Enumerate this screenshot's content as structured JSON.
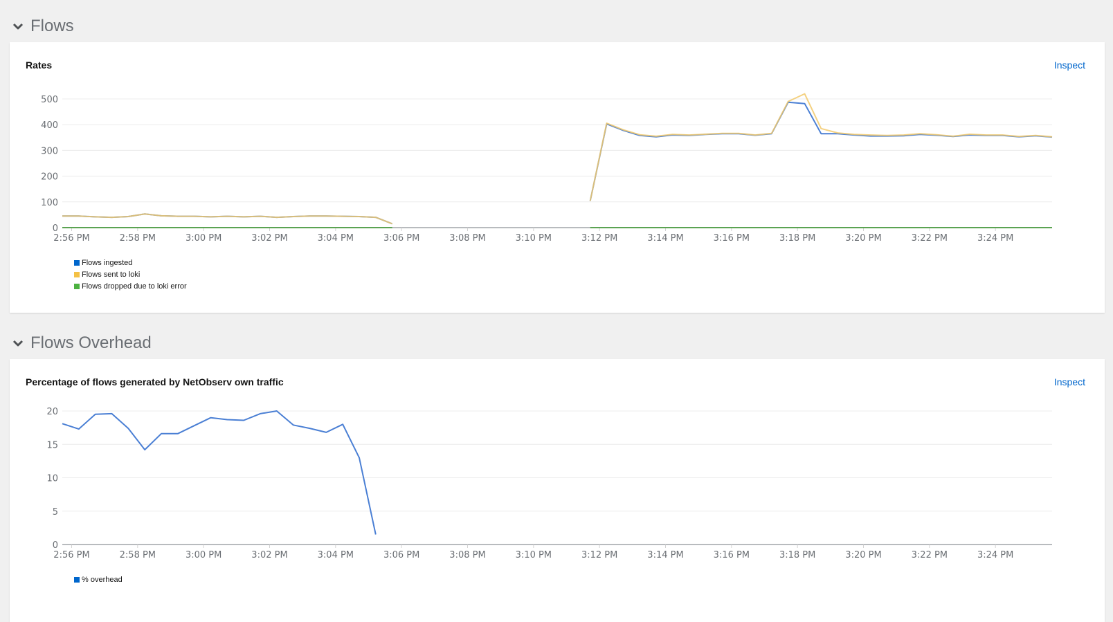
{
  "sections": [
    {
      "title": "Flows",
      "expanded": true,
      "card": {
        "title": "Rates",
        "inspect_label": "Inspect"
      }
    },
    {
      "title": "Flows Overhead",
      "expanded": true,
      "card": {
        "title": "Percentage of flows generated by NetObserv own traffic",
        "inspect_label": "Inspect"
      }
    }
  ],
  "chart_data": [
    {
      "type": "line",
      "title": "Rates",
      "xlabel": "",
      "ylabel": "",
      "ylim": [
        0,
        520
      ],
      "yticks": [
        0,
        100,
        200,
        300,
        400,
        500
      ],
      "xticks": [
        "2:56 PM",
        "2:58 PM",
        "3:00 PM",
        "3:02 PM",
        "3:04 PM",
        "3:06 PM",
        "3:08 PM",
        "3:10 PM",
        "3:12 PM",
        "3:14 PM",
        "3:16 PM",
        "3:18 PM",
        "3:20 PM",
        "3:22 PM",
        "3:24 PM"
      ],
      "x_range_minutes": [
        "2:55:43 PM",
        "3:25:43 PM"
      ],
      "grid": true,
      "legend_position": "bottom-left",
      "series": [
        {
          "name": "Flows ingested",
          "color": "#06c",
          "line_color": "#4a7fd4",
          "segments": [
            {
              "start": "2:55:43 PM",
              "step_seconds": 30,
              "values": [
                45,
                45,
                42,
                40,
                43,
                53,
                46,
                44,
                44,
                42,
                44,
                42,
                44,
                40,
                43,
                45,
                45,
                44,
                43,
                40,
                15
              ]
            },
            {
              "start": "3:11:43 PM",
              "step_seconds": 30,
              "values": [
                104,
                403,
                378,
                358,
                353,
                360,
                358,
                362,
                365,
                365,
                359,
                365,
                487,
                482,
                365,
                365,
                360,
                356,
                356,
                357,
                362,
                359,
                354,
                360,
                358,
                358,
                353,
                357,
                352
              ]
            }
          ]
        },
        {
          "name": "Flows sent to loki",
          "color": "#f4c145",
          "line_color": "#f2c96b",
          "segments": [
            {
              "start": "2:55:43 PM",
              "step_seconds": 30,
              "values": [
                45,
                45,
                42,
                40,
                43,
                53,
                46,
                44,
                44,
                42,
                44,
                42,
                44,
                40,
                43,
                45,
                45,
                44,
                43,
                40,
                15
              ]
            },
            {
              "start": "3:11:43 PM",
              "step_seconds": 30,
              "values": [
                104,
                406,
                380,
                361,
                355,
                362,
                360,
                363,
                366,
                366,
                360,
                366,
                490,
                520,
                385,
                368,
                362,
                360,
                358,
                360,
                365,
                361,
                355,
                363,
                360,
                360,
                354,
                358,
                353
              ]
            }
          ]
        },
        {
          "name": "Flows dropped due to loki error",
          "color": "#4cb140",
          "line_color": "#5ba352",
          "segments": [
            {
              "start": "2:55:43 PM",
              "step_seconds": 30,
              "values": [
                0,
                0,
                0,
                0,
                0,
                0,
                0,
                0,
                0,
                0,
                0,
                0,
                0,
                0,
                0,
                0,
                0,
                0,
                0,
                0,
                0
              ]
            },
            {
              "start": "3:11:43 PM",
              "step_seconds": 30,
              "values": [
                0,
                0,
                0,
                0,
                0,
                0,
                0,
                0,
                0,
                0,
                0,
                0,
                0,
                0,
                0,
                0,
                0,
                0,
                0,
                0,
                0,
                0,
                0,
                0,
                0,
                0,
                0,
                0,
                0
              ]
            }
          ]
        }
      ]
    },
    {
      "type": "line",
      "title": "Percentage of flows generated by NetObserv own traffic",
      "xlabel": "",
      "ylabel": "",
      "ylim": [
        0,
        20
      ],
      "yticks": [
        0,
        5,
        10,
        15,
        20
      ],
      "xticks": [
        "2:56 PM",
        "2:58 PM",
        "3:00 PM",
        "3:02 PM",
        "3:04 PM",
        "3:06 PM",
        "3:08 PM",
        "3:10 PM",
        "3:12 PM",
        "3:14 PM",
        "3:16 PM",
        "3:18 PM",
        "3:20 PM",
        "3:22 PM",
        "3:24 PM"
      ],
      "x_range_minutes": [
        "2:55:43 PM",
        "3:25:43 PM"
      ],
      "grid": true,
      "legend_position": "bottom-left",
      "series": [
        {
          "name": "% overhead",
          "color": "#06c",
          "line_color": "#4a7fd4",
          "segments": [
            {
              "start": "2:55:43 PM",
              "step_seconds": 30,
              "values": [
                18.1,
                17.3,
                19.5,
                19.6,
                17.4,
                14.2,
                16.6,
                16.6,
                17.8,
                19.0,
                18.7,
                18.6,
                19.6,
                20.0,
                17.9,
                17.4,
                16.8,
                18.0,
                13.0,
                1.5
              ]
            }
          ]
        }
      ]
    }
  ]
}
